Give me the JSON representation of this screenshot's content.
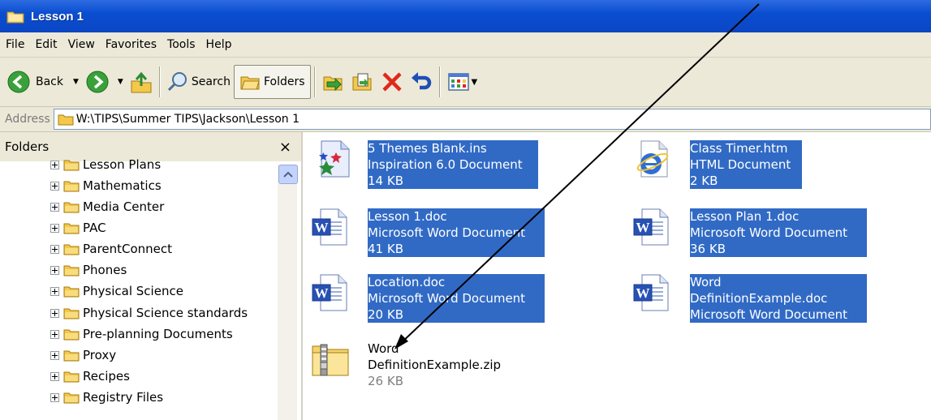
{
  "window": {
    "title": "Lesson 1"
  },
  "menu": [
    "File",
    "Edit",
    "View",
    "Favorites",
    "Tools",
    "Help"
  ],
  "toolbar": {
    "back_label": "Back",
    "search_label": "Search",
    "folders_label": "Folders"
  },
  "address": {
    "label": "Address",
    "path": "W:\\TIPS\\Summer TIPS\\Jackson\\Lesson 1"
  },
  "left_pane": {
    "title": "Folders",
    "close_glyph": "×",
    "items": [
      "Lesson Plans",
      "Mathematics",
      "Media Center",
      "PAC",
      "ParentConnect",
      "Phones",
      "Physical Science",
      "Physical Science standards",
      "Pre-planning Documents",
      "Proxy",
      "Recipes",
      "Registry Files"
    ]
  },
  "files": [
    {
      "line1": "5 Themes Blank.ins",
      "line2": "Inspiration 6.0 Document",
      "line3": "14 KB",
      "icon": "inspiration-doc-icon",
      "selected": true
    },
    {
      "line1": "Class Timer.htm",
      "line2": "HTML Document",
      "line3": "2 KB",
      "icon": "ie-html-doc-icon",
      "selected": true
    },
    {
      "line1": "Lesson 1.doc",
      "line2": "Microsoft Word Document",
      "line3": "41 KB",
      "icon": "word-doc-icon",
      "selected": true
    },
    {
      "line1": "Lesson Plan 1.doc",
      "line2": "Microsoft Word Document",
      "line3": "36 KB",
      "icon": "word-doc-icon",
      "selected": true
    },
    {
      "line1": "Location.doc",
      "line2": "Microsoft Word Document",
      "line3": "20 KB",
      "icon": "word-doc-icon",
      "selected": true
    },
    {
      "line1": "Word",
      "line2": "DefinitionExample.doc",
      "line3": "Microsoft Word Document",
      "icon": "word-doc-icon",
      "selected": true
    },
    {
      "line1": "Word",
      "line2": "DefinitionExample.zip",
      "line3": "26 KB",
      "icon": "zip-folder-icon",
      "selected": false
    }
  ],
  "colors": {
    "title_bar": "#0a4ed1",
    "selection": "#316ac5",
    "chrome": "#ece9d8"
  }
}
